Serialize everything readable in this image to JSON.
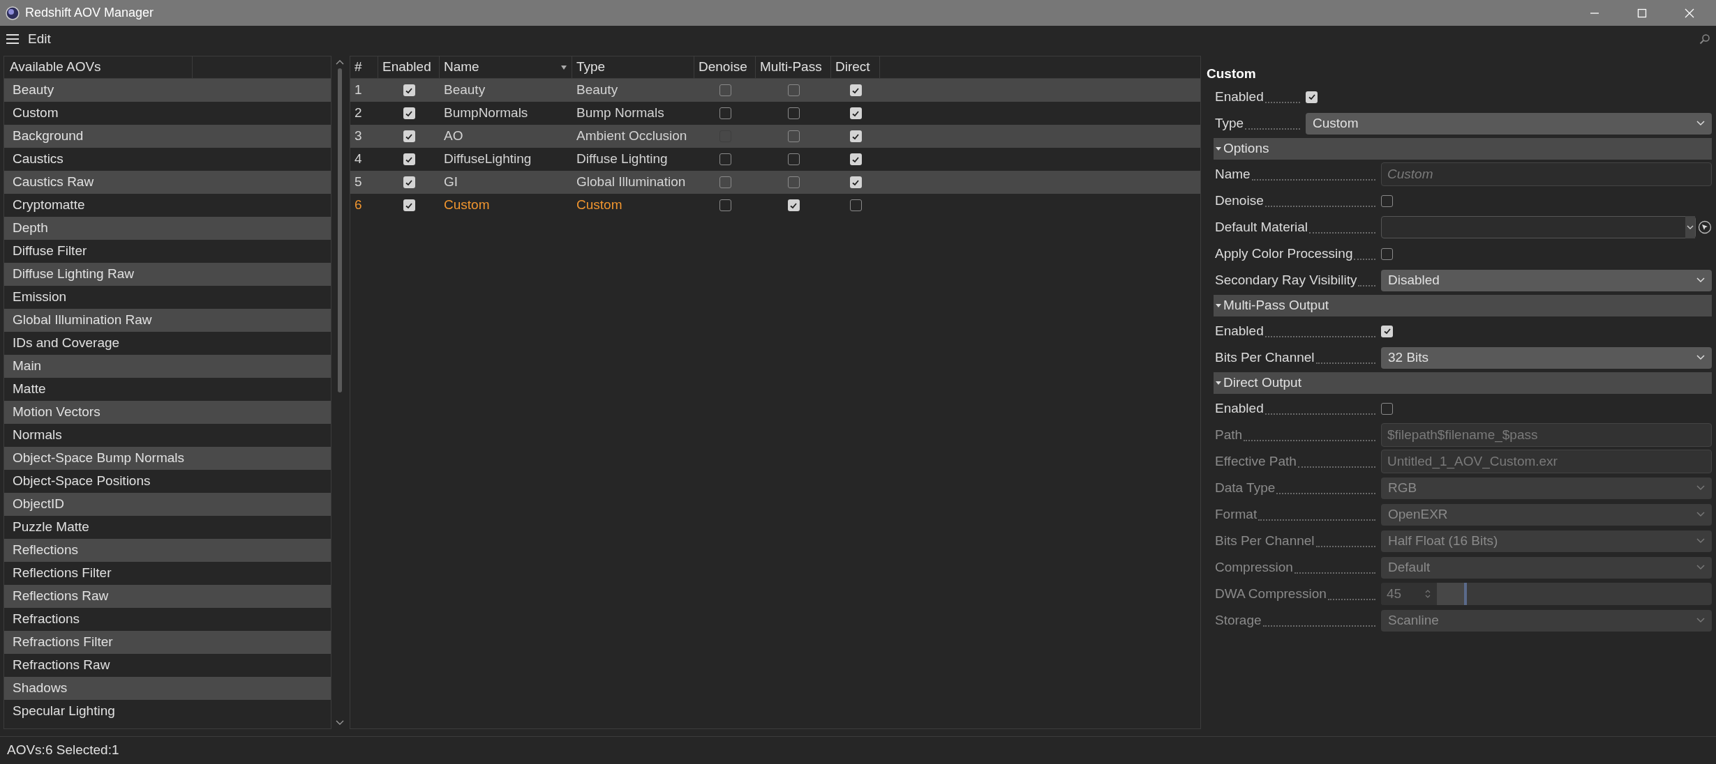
{
  "window": {
    "title": "Redshift AOV Manager"
  },
  "menu": {
    "label": "Edit"
  },
  "available_aovs": {
    "columns": [
      "Available AOVs"
    ],
    "items": [
      "Beauty",
      "Custom",
      "Background",
      "Caustics",
      "Caustics Raw",
      "Cryptomatte",
      "Depth",
      "Diffuse Filter",
      "Diffuse Lighting Raw",
      "Emission",
      "Global Illumination Raw",
      "IDs and Coverage",
      "Main",
      "Matte",
      "Motion Vectors",
      "Normals",
      "Object-Space Bump Normals",
      "Object-Space Positions",
      "ObjectID",
      "Puzzle Matte",
      "Reflections",
      "Reflections Filter",
      "Reflections Raw",
      "Refractions",
      "Refractions Filter",
      "Refractions Raw",
      "Shadows",
      "Specular Lighting"
    ]
  },
  "aov_table": {
    "columns": [
      "#",
      "Enabled",
      "Name",
      "Type",
      "Denoise",
      "Multi-Pass",
      "Direct"
    ],
    "rows": [
      {
        "number": "1",
        "enabled": {
          "checked": true
        },
        "name": "Beauty",
        "type": "Beauty",
        "denoise": {
          "checked": false,
          "disabled": false
        },
        "multi_pass": {
          "checked": false
        },
        "direct": {
          "checked": true
        },
        "selected": false
      },
      {
        "number": "2",
        "enabled": {
          "checked": true
        },
        "name": "BumpNormals",
        "type": "Bump Normals",
        "denoise": {
          "checked": false,
          "disabled": false
        },
        "multi_pass": {
          "checked": false
        },
        "direct": {
          "checked": true
        },
        "selected": false
      },
      {
        "number": "3",
        "enabled": {
          "checked": true
        },
        "name": "AO",
        "type": "Ambient Occlusion",
        "denoise": {
          "checked": false,
          "disabled": true
        },
        "multi_pass": {
          "checked": false
        },
        "direct": {
          "checked": true
        },
        "selected": false
      },
      {
        "number": "4",
        "enabled": {
          "checked": true
        },
        "name": "DiffuseLighting",
        "type": "Diffuse Lighting",
        "denoise": {
          "checked": false,
          "disabled": false
        },
        "multi_pass": {
          "checked": false
        },
        "direct": {
          "checked": true
        },
        "selected": false
      },
      {
        "number": "5",
        "enabled": {
          "checked": true
        },
        "name": "GI",
        "type": "Global Illumination",
        "denoise": {
          "checked": false,
          "disabled": false
        },
        "multi_pass": {
          "checked": false
        },
        "direct": {
          "checked": true
        },
        "selected": false
      },
      {
        "number": "6",
        "enabled": {
          "checked": true
        },
        "name": "Custom",
        "type": "Custom",
        "denoise": {
          "checked": false,
          "disabled": false
        },
        "multi_pass": {
          "checked": true
        },
        "direct": {
          "checked": false
        },
        "selected": true
      }
    ]
  },
  "inspector": {
    "title": "Custom",
    "fields": [
      {
        "kind": "checkbox",
        "label": "Enabled",
        "checked": true,
        "disabled": false
      },
      {
        "kind": "dropdown",
        "label": "Type",
        "value": "Custom",
        "disabled": false
      }
    ],
    "sections": [
      {
        "title": "Options",
        "expanded": true,
        "fields": [
          {
            "kind": "text",
            "label": "Name",
            "placeholder": "Custom",
            "disabled": false
          },
          {
            "kind": "checkbox",
            "label": "Denoise",
            "checked": false,
            "disabled": false
          },
          {
            "kind": "material",
            "label": "Default Material",
            "disabled": false
          },
          {
            "kind": "checkbox",
            "label": "Apply Color Processing",
            "checked": false,
            "disabled": false
          },
          {
            "kind": "dropdown",
            "label": "Secondary Ray Visibility",
            "value": "Disabled",
            "disabled": false
          }
        ]
      },
      {
        "title": "Multi-Pass Output",
        "expanded": true,
        "fields": [
          {
            "kind": "checkbox",
            "label": "Enabled",
            "checked": true,
            "disabled": false
          },
          {
            "kind": "dropdown",
            "label": "Bits Per Channel",
            "value": "32 Bits",
            "disabled": false
          }
        ]
      },
      {
        "title": "Direct Output",
        "expanded": true,
        "fields": [
          {
            "kind": "checkbox",
            "label": "Enabled",
            "checked": false,
            "disabled": false
          },
          {
            "kind": "text",
            "label": "Path",
            "value": "$filepath$filename_$pass",
            "disabled": true
          },
          {
            "kind": "text",
            "label": "Effective Path",
            "value": "Untitled_1_AOV_Custom.exr",
            "disabled": true
          },
          {
            "kind": "dropdown",
            "label": "Data Type",
            "value": "RGB",
            "disabled": true
          },
          {
            "kind": "dropdown",
            "label": "Format",
            "value": "OpenEXR",
            "disabled": true
          },
          {
            "kind": "dropdown",
            "label": "Bits Per Channel",
            "value": "Half Float (16 Bits)",
            "disabled": true
          },
          {
            "kind": "dropdown",
            "label": "Compression",
            "value": "Default",
            "disabled": true
          },
          {
            "kind": "number_slider",
            "label": "DWA Compression",
            "value": "45",
            "level": 0.11,
            "disabled": true
          },
          {
            "kind": "dropdown",
            "label": "Storage",
            "value": "Scanline",
            "disabled": true
          }
        ]
      }
    ]
  },
  "status_bar": {
    "text": "AOVs:6 Selected:1"
  }
}
